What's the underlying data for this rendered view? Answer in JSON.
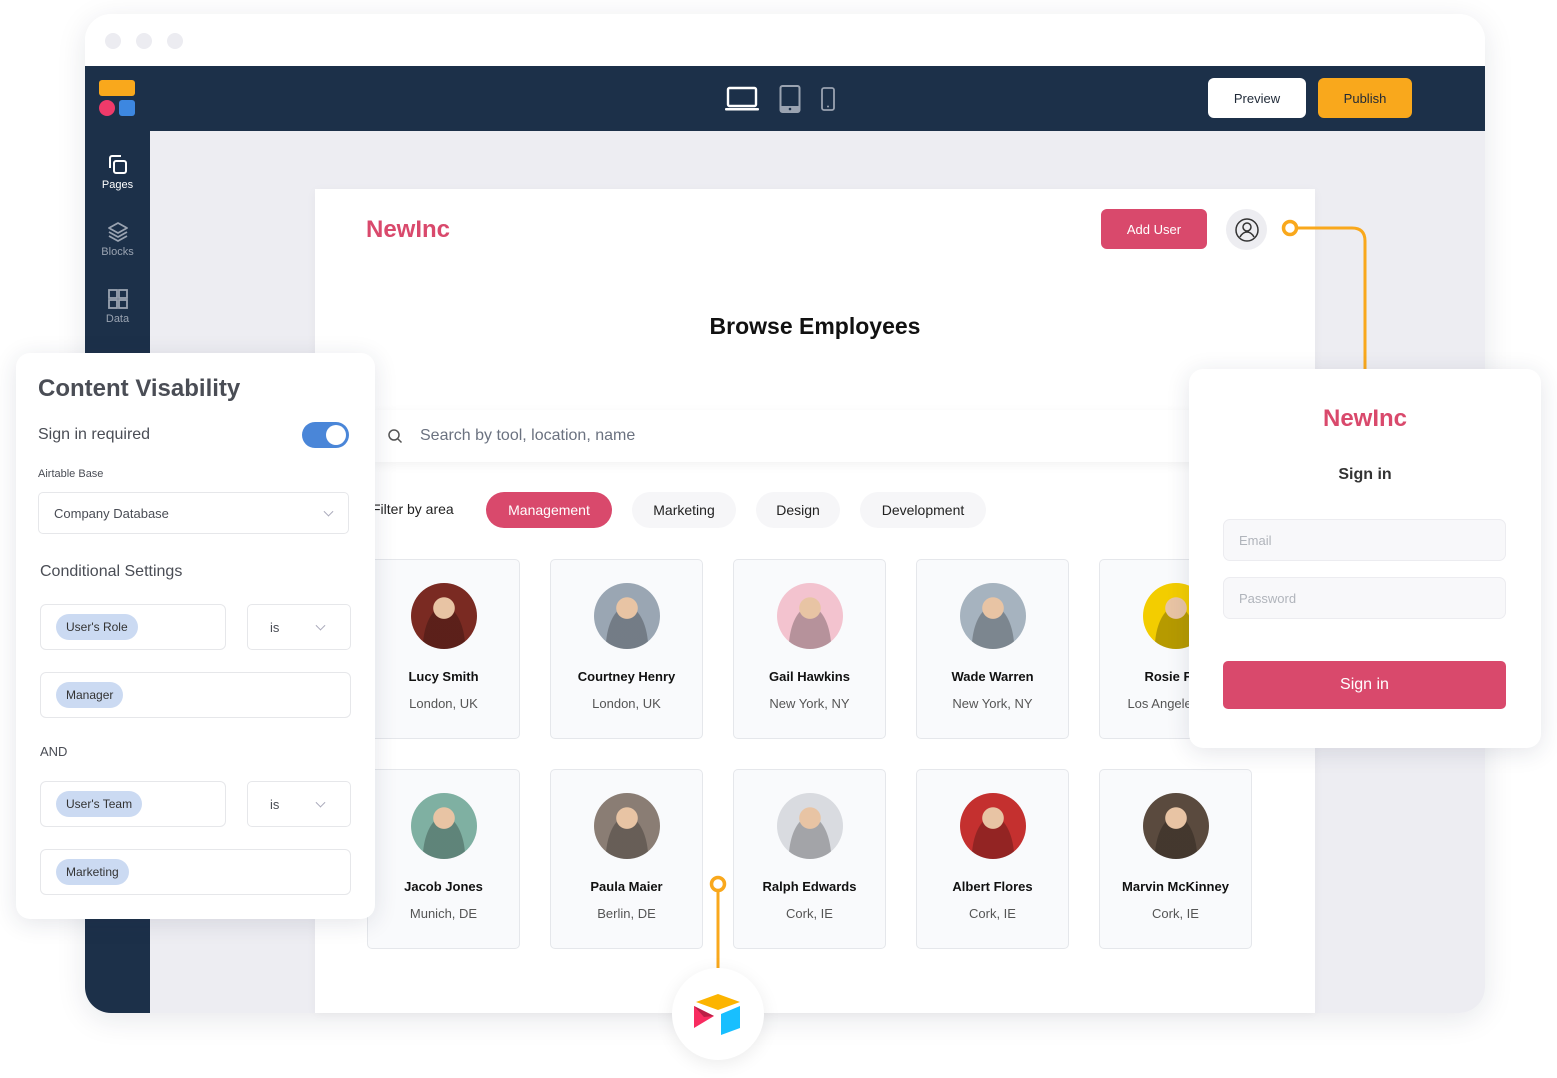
{
  "window": {
    "traffic_lights": [
      "dot",
      "dot",
      "dot"
    ]
  },
  "topbar": {
    "logo": "app-logo",
    "devices": [
      {
        "name": "desktop",
        "icon": "laptop-icon",
        "active": true
      },
      {
        "name": "tablet",
        "icon": "tablet-icon",
        "active": false
      },
      {
        "name": "mobile",
        "icon": "phone-icon",
        "active": false
      }
    ],
    "preview_label": "Preview",
    "publish_label": "Publish",
    "colors": {
      "bar": "#1c3049",
      "publish": "#f9a81c"
    }
  },
  "sidebar": {
    "items": [
      {
        "label": "Pages",
        "icon": "pages-icon",
        "active": true
      },
      {
        "label": "Blocks",
        "icon": "layers-icon",
        "active": false
      },
      {
        "label": "Data",
        "icon": "grid-icon",
        "active": false
      }
    ]
  },
  "page": {
    "brand": "NewInc",
    "add_user_label": "Add User",
    "title": "Browse Employees",
    "search_placeholder": "Search by tool, location, name",
    "filter_label": "Filter by area",
    "filters": [
      {
        "label": "Management",
        "active": true
      },
      {
        "label": "Marketing",
        "active": false
      },
      {
        "label": "Design",
        "active": false
      },
      {
        "label": "Development",
        "active": false
      }
    ],
    "employees": [
      {
        "name": "Lucy Smith",
        "location": "London, UK",
        "photo_bg": "#7a2a22"
      },
      {
        "name": "Courtney Henry",
        "location": "London, UK",
        "photo_bg": "#9aa6b3"
      },
      {
        "name": "Gail Hawkins",
        "location": "New York, NY",
        "photo_bg": "#f3c3cf"
      },
      {
        "name": "Wade Warren",
        "location": "New York, NY",
        "photo_bg": "#a6b3bf"
      },
      {
        "name": "Rosie Fox",
        "location": "Los Angeles, CA",
        "photo_bg": "#f3cd00"
      },
      {
        "name": "Jacob Jones",
        "location": "Munich, DE",
        "photo_bg": "#7fb0a2"
      },
      {
        "name": "Paula Maier",
        "location": "Berlin, DE",
        "photo_bg": "#8a7d74"
      },
      {
        "name": "Ralph Edwards",
        "location": "Cork, IE",
        "photo_bg": "#d9dbe0"
      },
      {
        "name": "Albert Flores",
        "location": "Cork, IE",
        "photo_bg": "#c4302f"
      },
      {
        "name": "Marvin McKinney",
        "location": "Cork, IE",
        "photo_bg": "#5a4a3e"
      }
    ],
    "accent": "#d9496c"
  },
  "visibility_panel": {
    "title": "Content Visability",
    "sign_in_required_label": "Sign in required",
    "sign_in_required": true,
    "base_label": "Airtable Base",
    "base_value": "Company Database",
    "conditional_heading": "Conditional Settings",
    "conditions": [
      {
        "field": "User's Role",
        "operator": "is",
        "value": "Manager"
      },
      {
        "field": "User's Team",
        "operator": "is",
        "value": "Marketing"
      }
    ],
    "joiner": "AND"
  },
  "signin_panel": {
    "brand": "NewInc",
    "heading": "Sign in",
    "email_placeholder": "Email",
    "password_placeholder": "Password",
    "submit_label": "Sign in"
  },
  "integration": {
    "icon": "airtable-logo-icon"
  }
}
